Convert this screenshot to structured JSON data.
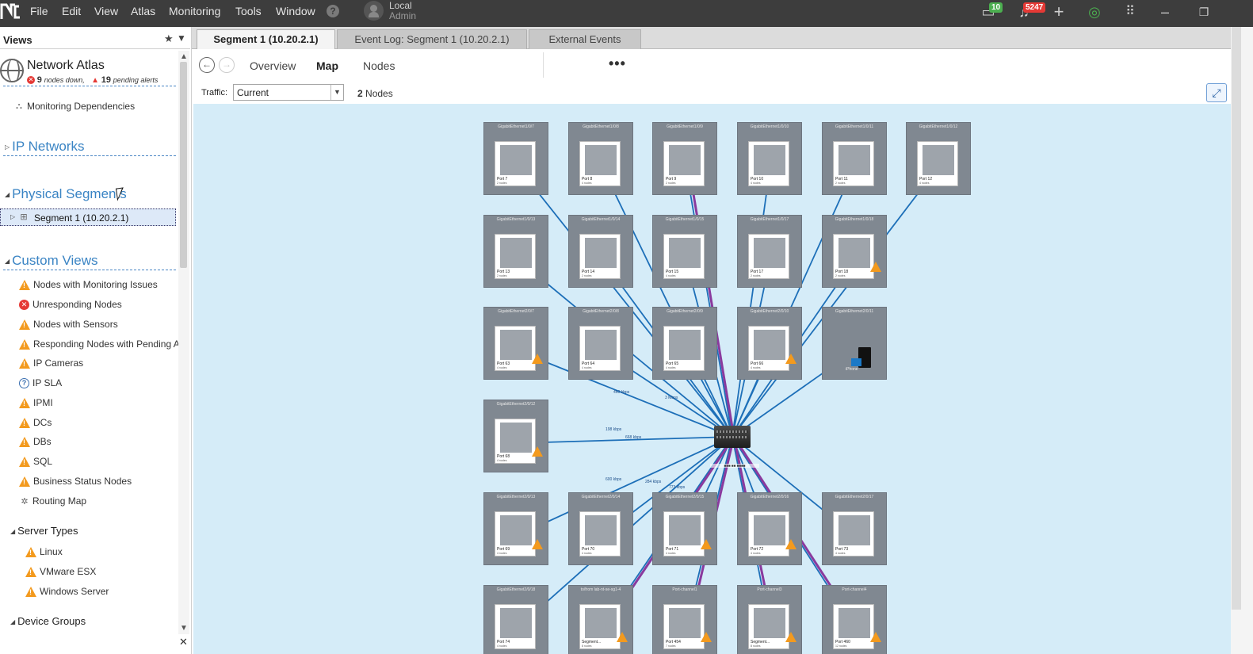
{
  "menu": {
    "items": [
      "File",
      "Edit",
      "View",
      "Atlas",
      "Monitoring",
      "Tools",
      "Window"
    ],
    "help": "?",
    "user_name": "Local",
    "user_role": "Admin",
    "msg_count": "10",
    "alert_count": "5247"
  },
  "views": {
    "title": "Views",
    "atlas_title": "Network Atlas",
    "nodes_down_count": "9",
    "nodes_down_label": "nodes down,",
    "pending_count": "19",
    "pending_label": "pending alerts",
    "monitoring_deps": "Monitoring Dependencies",
    "ip_networks": "IP Networks",
    "physical_segments": "Physical Segments",
    "segment_item": "Segment 1 (10.20.2.1)",
    "custom_views": "Custom Views",
    "custom_items": [
      {
        "label": "Nodes with Monitoring Issues",
        "icon": "warning-icon"
      },
      {
        "label": "Unresponding Nodes",
        "icon": "error-icon"
      },
      {
        "label": "Nodes with Sensors",
        "icon": "warning-icon"
      },
      {
        "label": "Responding Nodes with Pending A",
        "icon": "warning-icon"
      },
      {
        "label": "IP Cameras",
        "icon": "warning-icon"
      },
      {
        "label": "IP SLA",
        "icon": "question-icon"
      },
      {
        "label": "IPMI",
        "icon": "warning-icon"
      },
      {
        "label": "DCs",
        "icon": "warning-icon"
      },
      {
        "label": "DBs",
        "icon": "warning-icon"
      },
      {
        "label": "SQL",
        "icon": "warning-icon"
      },
      {
        "label": "Business Status Nodes",
        "icon": "warning-icon"
      },
      {
        "label": "Routing Map",
        "icon": "routing-icon"
      }
    ],
    "server_types": "Server Types",
    "server_items": [
      "Linux",
      "VMware ESX",
      "Windows Server"
    ],
    "device_groups": "Device Groups"
  },
  "tabs": [
    {
      "label": "Segment 1 (10.20.2.1)",
      "active": true
    },
    {
      "label": "Event Log: Segment 1 (10.20.2.1)",
      "active": false
    },
    {
      "label": "External Events",
      "active": false
    }
  ],
  "view_tabs": [
    "Overview",
    "Map",
    "Nodes"
  ],
  "more": "•••",
  "filter": {
    "traffic_label": "Traffic:",
    "traffic_value": "Current",
    "node_count": "2",
    "node_count_label": "Nodes"
  },
  "map": {
    "ports": [
      {
        "name": "GigabitEthernet1/0/7",
        "label": "Port 7",
        "sub": "2 nodes",
        "warn": false
      },
      {
        "name": "GigabitEthernet1/0/8",
        "label": "Port 8",
        "sub": "4 nodes",
        "warn": false
      },
      {
        "name": "GigabitEthernet1/0/9",
        "label": "Port 9",
        "sub": "2 nodes",
        "warn": false
      },
      {
        "name": "GigabitEthernet1/0/10",
        "label": "Port 10",
        "sub": "4 nodes",
        "warn": false
      },
      {
        "name": "GigabitEthernet1/0/11",
        "label": "Port 11",
        "sub": "2 nodes",
        "warn": false
      },
      {
        "name": "GigabitEthernet1/0/12",
        "label": "Port 12",
        "sub": "4 nodes",
        "warn": false
      },
      {
        "name": "GigabitEthernet1/0/13",
        "label": "Port 13",
        "sub": "2 nodes",
        "warn": false
      },
      {
        "name": "GigabitEthernet1/0/14",
        "label": "Port 14",
        "sub": "2 nodes",
        "warn": false
      },
      {
        "name": "GigabitEthernet1/0/15",
        "label": "Port 15",
        "sub": "4 nodes",
        "warn": false
      },
      {
        "name": "GigabitEthernet1/0/17",
        "label": "Port 17",
        "sub": "2 nodes",
        "warn": false
      },
      {
        "name": "GigabitEthernet1/0/18",
        "label": "Port 18",
        "sub": "2 nodes",
        "warn": true
      },
      {
        "name": "GigabitEthernet2/0/7",
        "label": "Port 63",
        "sub": "4 nodes",
        "warn": true
      },
      {
        "name": "GigabitEthernet2/0/8",
        "label": "Port 64",
        "sub": "4 nodes",
        "warn": false
      },
      {
        "name": "GigabitEthernet2/0/9",
        "label": "Port 65",
        "sub": "4 nodes",
        "warn": false
      },
      {
        "name": "GigabitEthernet2/0/10",
        "label": "Port 66",
        "sub": "4 nodes",
        "warn": true
      },
      {
        "name": "GigabitEthernet2/0/12",
        "label": "Port 68",
        "sub": "4 nodes",
        "warn": true
      },
      {
        "name": "GigabitEthernet2/0/13",
        "label": "Port 69",
        "sub": "4 nodes",
        "warn": true
      },
      {
        "name": "GigabitEthernet2/0/14",
        "label": "Port 70",
        "sub": "4 nodes",
        "warn": false
      },
      {
        "name": "GigabitEthernet2/0/15",
        "label": "Port 71",
        "sub": "4 nodes",
        "warn": true
      },
      {
        "name": "GigabitEthernet2/0/16",
        "label": "Port 72",
        "sub": "4 nodes",
        "warn": true
      },
      {
        "name": "GigabitEthernet2/0/17",
        "label": "Port 73",
        "sub": "4 nodes",
        "warn": false
      },
      {
        "name": "GigabitEthernet2/0/18",
        "label": "Port 74",
        "sub": "4 nodes",
        "warn": false
      },
      {
        "name": "to/from lab-nt-se-sg1-4",
        "label": "Segment...",
        "sub": "8 nodes",
        "warn": true
      },
      {
        "name": "Port-channel1",
        "label": "Port 454",
        "sub": "7 nodes",
        "warn": true
      },
      {
        "name": "Port-channel3",
        "label": "Segment...",
        "sub": "8 nodes",
        "warn": true
      },
      {
        "name": "Port-channel4",
        "label": "Port 460",
        "sub": "12 nodes",
        "warn": true
      }
    ],
    "server": {
      "name": "GigabitEthernet2/0/11",
      "label": "iPhone"
    },
    "traffic_labels": [
      "198 kbps",
      "668 kbps",
      "460 kbps",
      "3 Mbps",
      "600 kbps",
      "284 kbps",
      "773 kbps"
    ]
  }
}
